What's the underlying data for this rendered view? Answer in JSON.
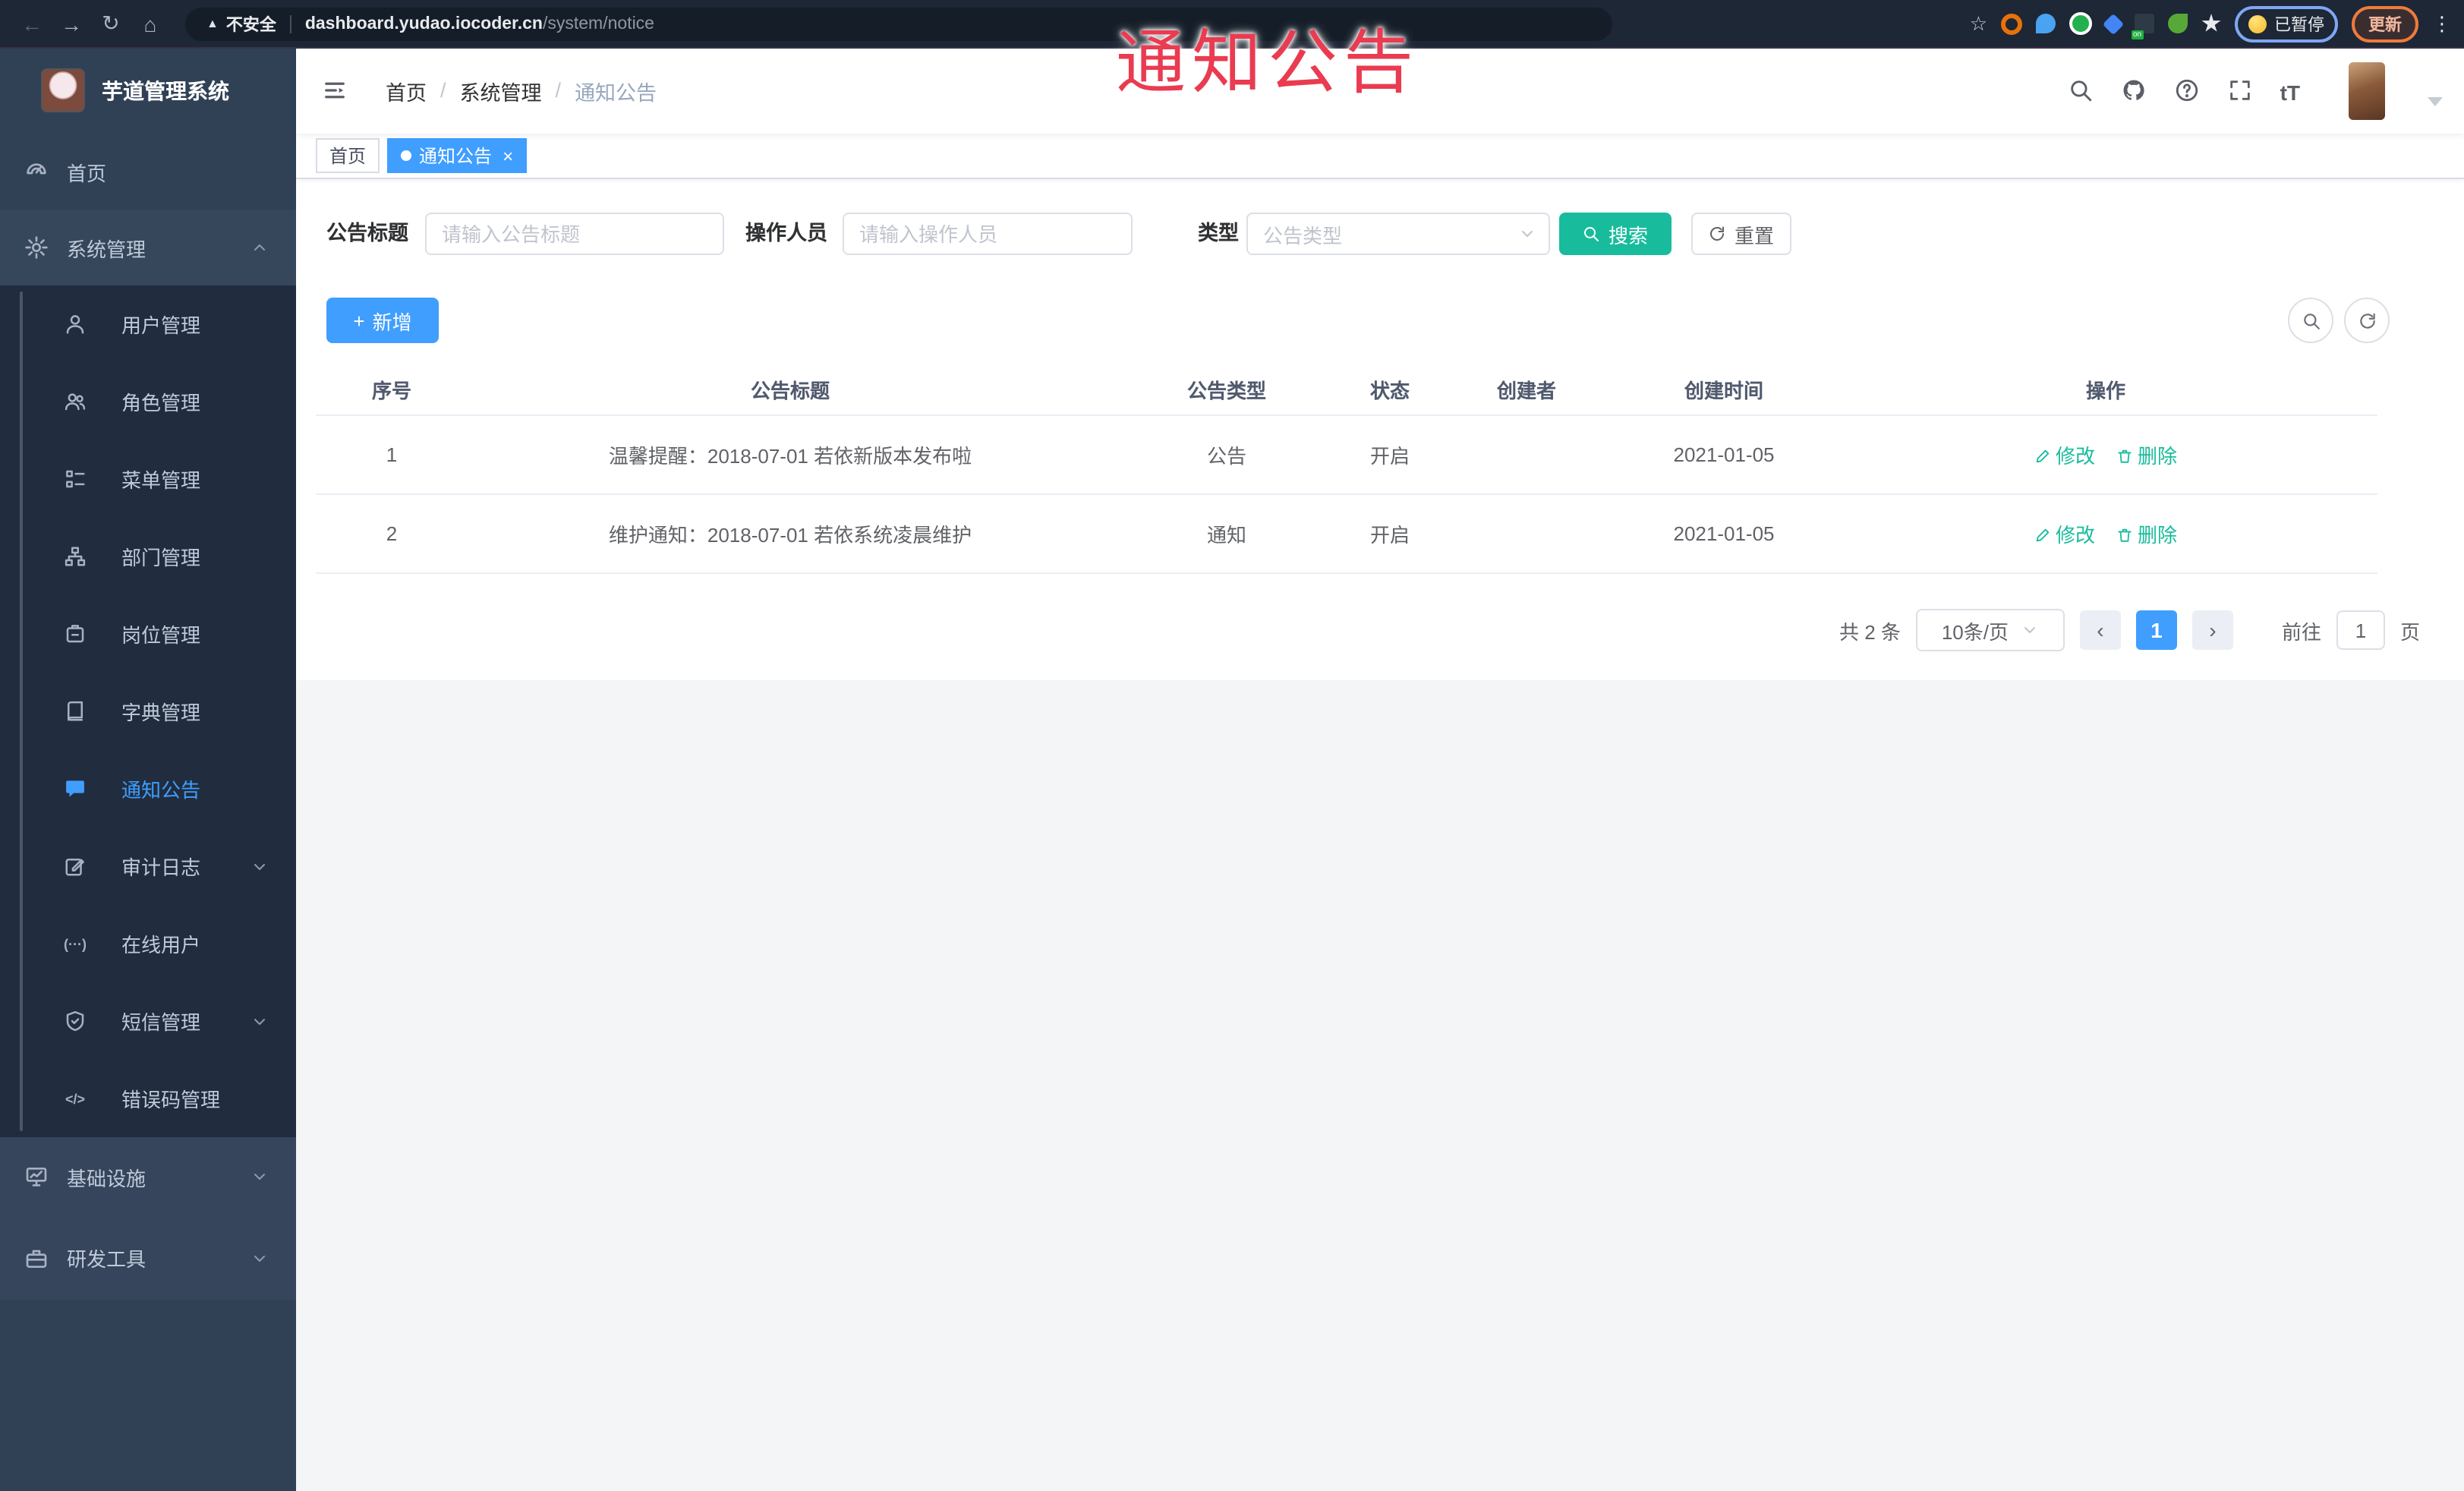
{
  "browser": {
    "back_icon": "←",
    "forward_icon": "→",
    "refresh_icon": "↻",
    "home_icon": "⌂",
    "warning_icon": "▲",
    "security_label": "不安全",
    "url_domain": "dashboard.yudao.iocoder.cn",
    "url_path": "/system/notice",
    "star_icon": "☆",
    "ext_on_badge": "on",
    "paused_label": "已暂停",
    "update_label": "更新",
    "menu_dots_icon": "⋮"
  },
  "overlay": {
    "text": "通知公告"
  },
  "sidebar": {
    "app_title": "芋道管理系统",
    "home": "首页",
    "system": "系统管理",
    "submenu": [
      "用户管理",
      "角色管理",
      "菜单管理",
      "部门管理",
      "岗位管理",
      "字典管理",
      "通知公告",
      "审计日志",
      "在线用户",
      "短信管理",
      "错误码管理"
    ],
    "infra": "基础设施",
    "devtools": "研发工具",
    "online_glyph": "(···)",
    "error_code_glyph": "</>"
  },
  "header": {
    "breadcrumb": [
      "首页",
      "系统管理",
      "通知公告"
    ],
    "separator": "/",
    "font_size_glyph": "tT"
  },
  "tabs": {
    "home": "首页",
    "active": "通知公告",
    "close_icon": "×"
  },
  "filters": {
    "title_label": "公告标题",
    "title_placeholder": "请输入公告标题",
    "operator_label": "操作人员",
    "operator_placeholder": "请输入操作人员",
    "type_label": "类型",
    "type_placeholder": "公告类型",
    "search_label": "搜索",
    "reset_label": "重置"
  },
  "toolbar": {
    "add_label": "新增",
    "add_plus": "+"
  },
  "table": {
    "headers": [
      "序号",
      "公告标题",
      "公告类型",
      "状态",
      "创建者",
      "创建时间",
      "操作"
    ],
    "rows": [
      {
        "no": "1",
        "title": "温馨提醒：2018-07-01 若依新版本发布啦",
        "type": "公告",
        "status": "开启",
        "creator": "",
        "created": "2021-01-05",
        "edit_label": "修改",
        "delete_label": "删除"
      },
      {
        "no": "2",
        "title": "维护通知：2018-07-01 若依系统凌晨维护",
        "type": "通知",
        "status": "开启",
        "creator": "",
        "created": "2021-01-05",
        "edit_label": "修改",
        "delete_label": "删除"
      }
    ]
  },
  "pagination": {
    "total": "共 2 条",
    "page_size": "10条/页",
    "prev_icon": "‹",
    "next_icon": "›",
    "page": "1",
    "goto_label": "前往",
    "goto_value": "1",
    "page_unit": "页"
  },
  "colors": {
    "accent_blue": "#409EFF",
    "teal": "#18bc9c",
    "overlay_red": "#ea3b50",
    "sidebar_bg": "#304156",
    "submenu_bg": "#212d3f",
    "chrome_bg": "#1d2735"
  }
}
